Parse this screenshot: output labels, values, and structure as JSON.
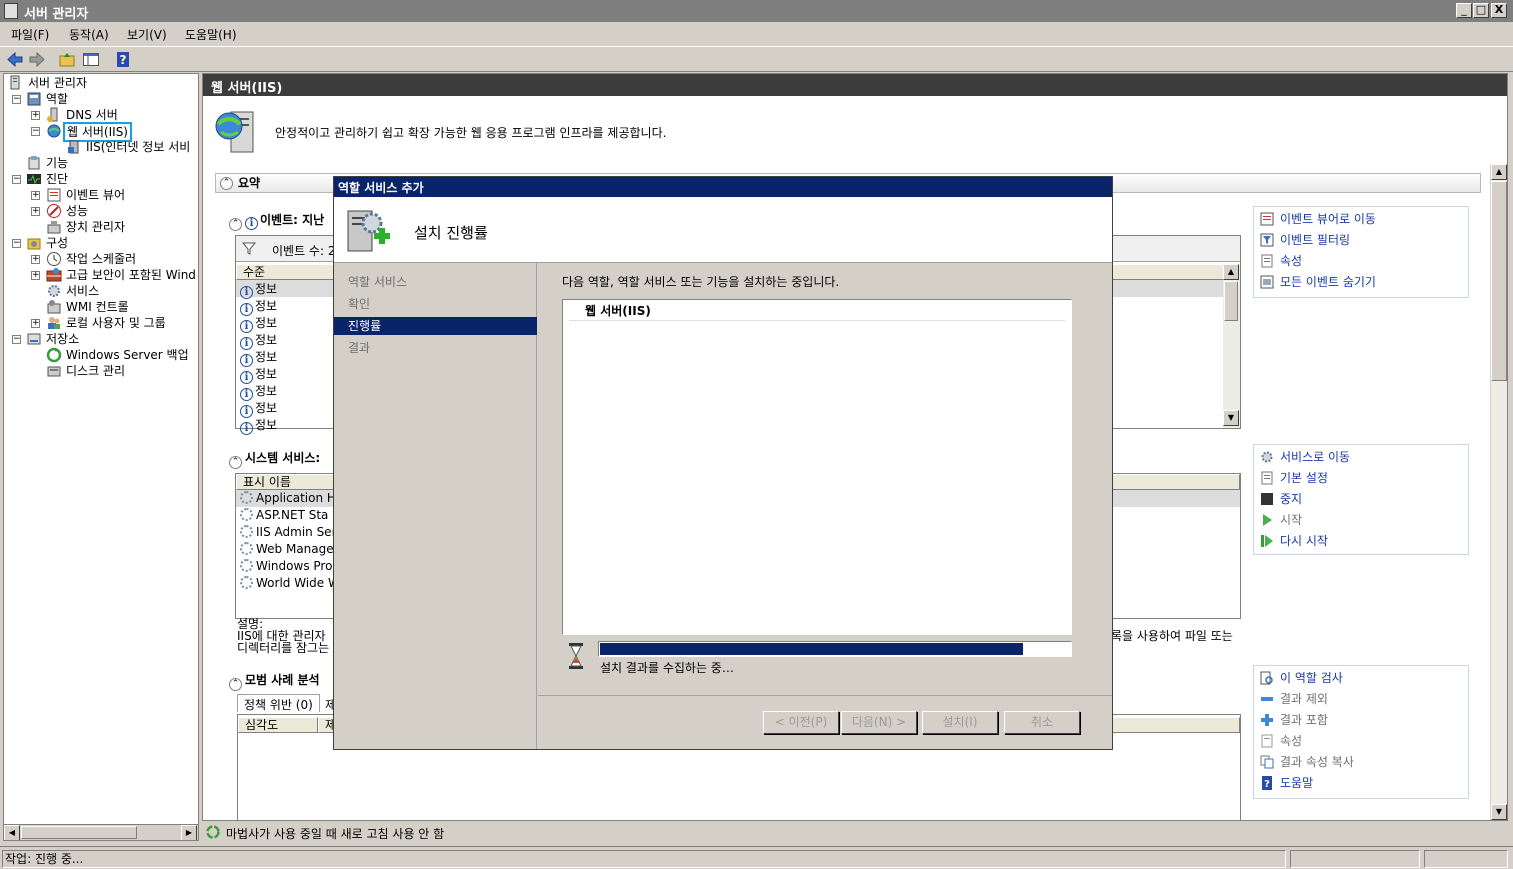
{
  "window": {
    "title": "서버 관리자",
    "minimize": "_",
    "restore": "□",
    "close": "X"
  },
  "menu": [
    "파일(F)",
    "동작(A)",
    "보기(V)",
    "도움말(H)"
  ],
  "tree": {
    "root": "서버 관리자",
    "roles": "역할",
    "dns": "DNS 서버",
    "iis": "웹 서버(IIS)",
    "iis_mgr": "IIS(인터넷 정보 서비",
    "features": "기능",
    "diagnostics": "진단",
    "event_viewer": "이벤트 뷰어",
    "performance": "성능",
    "device_mgr": "장치 관리자",
    "configuration": "구성",
    "task_scheduler": "작업 스케줄러",
    "firewall": "고급 보안이 포함된 Wind",
    "services": "서비스",
    "wmi": "WMI 컨트롤",
    "local_users": "로컬 사용자 및 그룹",
    "storage": "저장소",
    "backup": "Windows Server 백업",
    "disk_mgmt": "디스크 관리"
  },
  "main": {
    "header": "웹 서버(IIS)",
    "description": "안정적이고 관리하기 쉽고 확장 가능한 웹 응용 프로그램 인프라를 제공합니다.",
    "summary_label": "요약",
    "events_title": "이벤트: 지난",
    "events_filter": "이벤트 수: 2",
    "events_col": "수준",
    "events_rows": [
      "정보",
      "정보",
      "정보",
      "정보",
      "정보",
      "정보",
      "정보",
      "정보",
      "정보"
    ],
    "events_actions": [
      "이벤트 뷰어로 이동",
      "이벤트 필터링",
      "속성",
      "모든 이벤트 숨기기"
    ],
    "services_title": "시스템 서비스:",
    "services_col": "표시 이름",
    "services_rows": [
      "Application H",
      "ASP.NET Sta",
      "IIS Admin Ser",
      "Web Manage",
      "Windows Pro",
      "World Wide W"
    ],
    "services_actions": [
      "서비스로 이동",
      "기본 설정",
      "중지",
      "시작",
      "다시 시작"
    ],
    "description_label": "설명:",
    "description_text_1": "IIS에 대한 관리자",
    "description_text_2": "디렉터리를 잠그는",
    "description_text_right": "록을 사용하여 파일 또는",
    "bpa_title": "모범 사례 분석",
    "bpa_tab1": "정책 위반 (0)",
    "bpa_tab2": "제",
    "bpa_col1": "심각도",
    "bpa_col2": "제",
    "bpa_actions": [
      "이 역할 검사",
      "결과 제외",
      "결과 포함",
      "속성",
      "결과 속성 복사",
      "도움말"
    ],
    "footer_text": "마법사가 사용 중일 때 새로 고침 사용 안 함"
  },
  "dialog": {
    "title": "역할 서비스 추가",
    "heading": "설치 진행률",
    "steps": [
      "역할 서비스",
      "확인",
      "진행률",
      "결과"
    ],
    "active_step": 2,
    "message": "다음 역할, 역할 서비스 또는 기능을 설치하는 중입니다.",
    "install_item": "웹 서버(IIS)",
    "progress": 0.9,
    "progress_text": "설치 결과를 수집하는 중…",
    "buttons": {
      "prev": "< 이전(P)",
      "next": "다음(N) >",
      "install": "설치(I)",
      "cancel": "취소"
    }
  },
  "status": {
    "text": "작업: 진행 중..."
  },
  "colors": {
    "accent": "#0a246a",
    "link": "#1a3aa8",
    "header_dark": "#3c3c3c",
    "selection_outline": "#1aa0e0"
  }
}
